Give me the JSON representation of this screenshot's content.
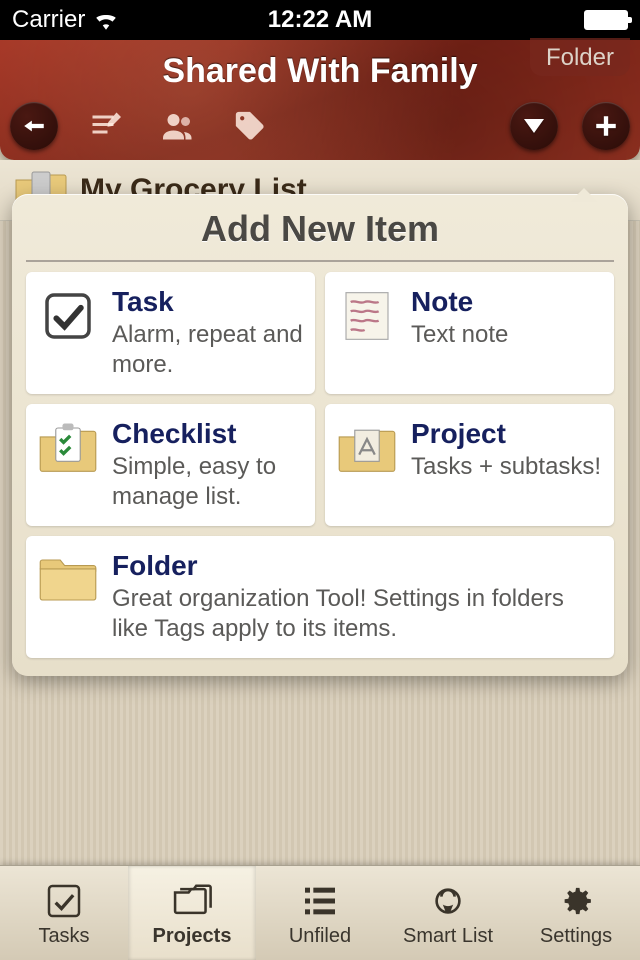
{
  "status": {
    "carrier": "Carrier",
    "time": "12:22 AM"
  },
  "header": {
    "folder_tab": "Folder",
    "title": "Shared With Family"
  },
  "list": {
    "item0": "My Grocery List"
  },
  "popover": {
    "title": "Add New Item",
    "task": {
      "title": "Task",
      "desc": "Alarm, repeat and more."
    },
    "note": {
      "title": "Note",
      "desc": "Text note"
    },
    "checklist": {
      "title": "Checklist",
      "desc": "Simple, easy to manage list."
    },
    "project": {
      "title": "Project",
      "desc": "Tasks + subtasks!"
    },
    "folder": {
      "title": "Folder",
      "desc": "Great organization Tool! Settings in folders like Tags apply to its items."
    }
  },
  "tabs": {
    "tasks": "Tasks",
    "projects": "Projects",
    "unfiled": "Unfiled",
    "smartlist": "Smart List",
    "settings": "Settings"
  }
}
